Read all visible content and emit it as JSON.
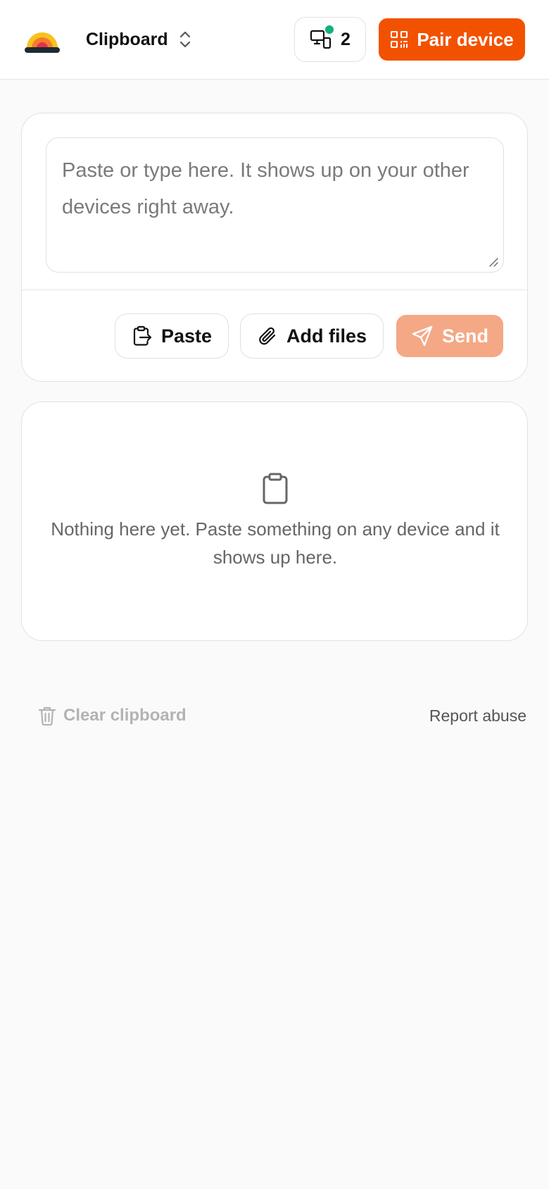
{
  "header": {
    "workspace_name": "Clipboard",
    "devices_count": "2",
    "pair_label": "Pair device",
    "accent_color": "#f25200",
    "online_color": "#14b07a"
  },
  "composer": {
    "placeholder": "Paste or type here. It shows up on your other devices right away.",
    "value": "",
    "paste_label": "Paste",
    "add_files_label": "Add files",
    "send_label": "Send",
    "send_disabled": true
  },
  "clipboard_list": {
    "empty_message": "Nothing here yet. Paste something on any device and it shows up here.",
    "items": []
  },
  "footer": {
    "clear_label": "Clear clipboard",
    "report_label": "Report abuse"
  },
  "icons": {
    "logo": "sunset-logo-icon",
    "workspace_switch": "chevron-up-down-icon",
    "devices": "devices-icon",
    "pair": "qr-code-icon",
    "paste": "clipboard-paste-icon",
    "add_files": "paperclip-icon",
    "send": "send-icon",
    "empty": "clipboard-icon",
    "clear": "trash-icon"
  }
}
